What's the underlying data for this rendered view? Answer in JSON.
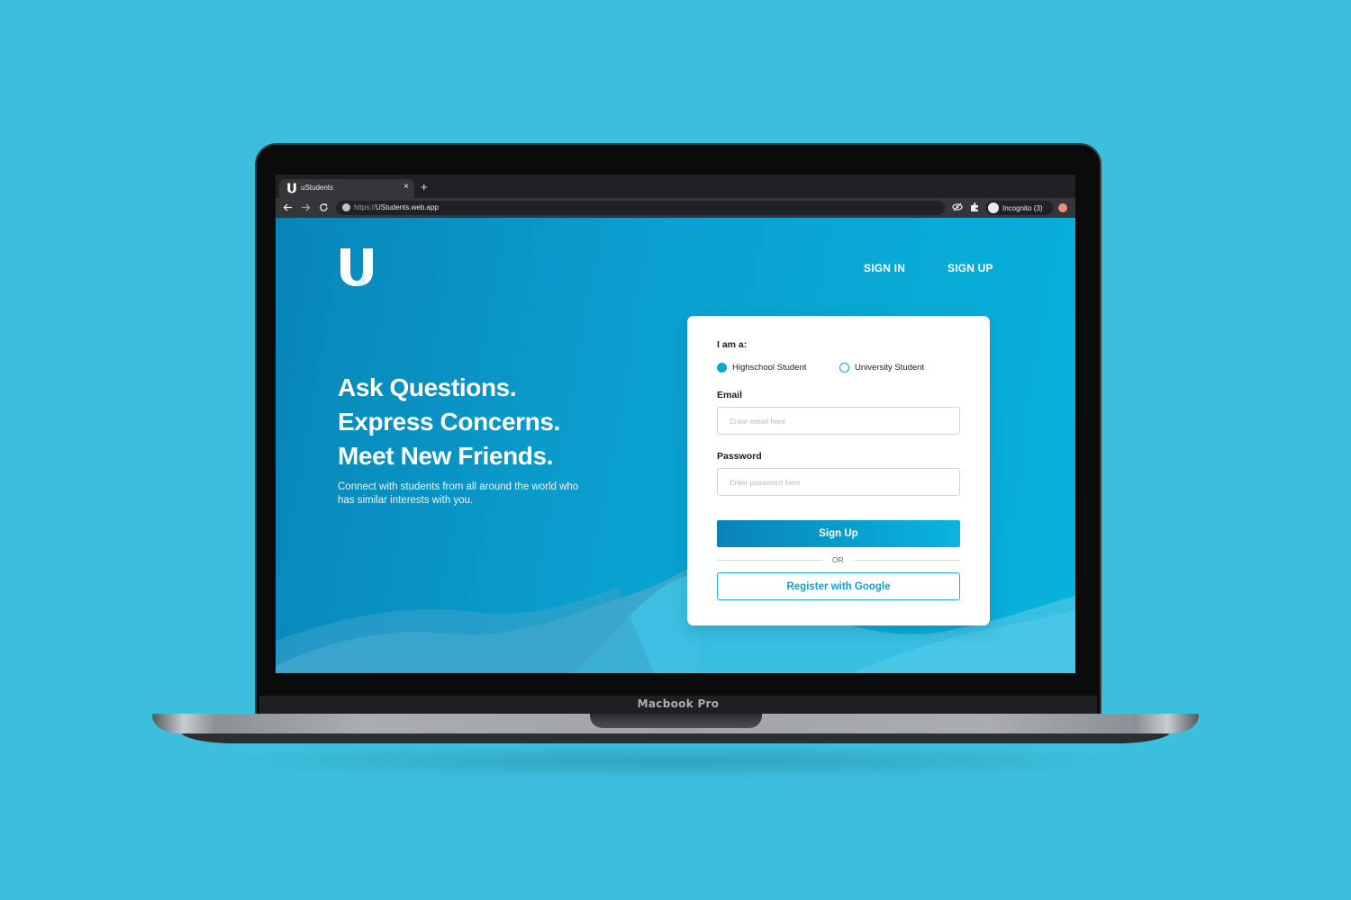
{
  "device": {
    "label": "Macbook Pro"
  },
  "browser": {
    "tab_title": "uStudents",
    "tab_close": "×",
    "new_tab": "+",
    "url_scheme": "https://",
    "url_host": "UStudents.web.app",
    "incognito_label": "Incognito (3)"
  },
  "header": {
    "nav": {
      "sign_in": "SIGN IN",
      "sign_up": "SIGN UP"
    }
  },
  "hero": {
    "line1": "Ask Questions.",
    "line2": "Express Concerns.",
    "line3": "Meet New Friends.",
    "subtitle": "Connect with students from all around the world who has similar interests with you."
  },
  "form": {
    "role_label": "I am a:",
    "roles": [
      {
        "label": "Highschool Student",
        "selected": true
      },
      {
        "label": "University Student",
        "selected": false
      }
    ],
    "email_label": "Email",
    "email_placeholder": "Enter email here",
    "password_label": "Password",
    "password_placeholder": "Enter password here",
    "submit_label": "Sign Up",
    "divider_text": "OR",
    "google_label": "Register with Google"
  },
  "colors": {
    "background": "#3bbfdd",
    "accent": "#08a7d6",
    "page_gradient_start": "#0885b8",
    "page_gradient_end": "#08b2dc"
  }
}
